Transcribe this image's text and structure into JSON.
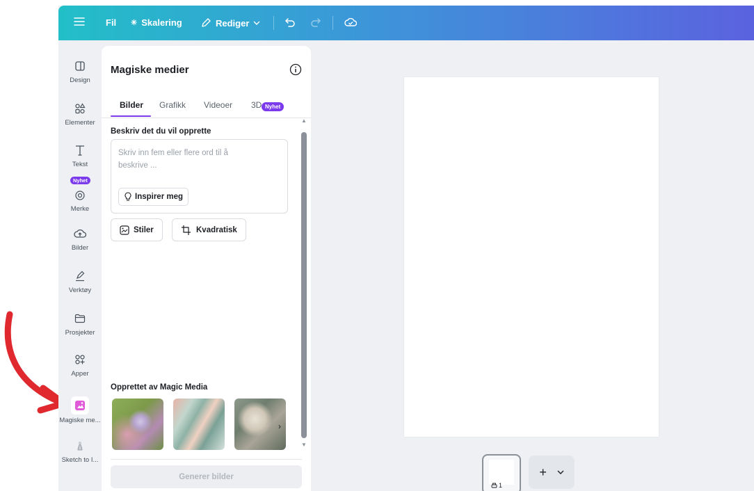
{
  "topbar": {
    "file_label": "Fil",
    "resize_label": "Skalering",
    "edit_label": "Rediger"
  },
  "rail": {
    "items": [
      {
        "label": "Design",
        "icon": "layout-icon"
      },
      {
        "label": "Elementer",
        "icon": "shapes-icon"
      },
      {
        "label": "Tekst",
        "icon": "text-icon"
      },
      {
        "label": "Merke",
        "icon": "brand-icon",
        "badge": "Nyhet"
      },
      {
        "label": "Bilder",
        "icon": "cloud-upload-icon"
      },
      {
        "label": "Verktøy",
        "icon": "pen-icon"
      },
      {
        "label": "Prosjekter",
        "icon": "folder-icon"
      },
      {
        "label": "Apper",
        "icon": "apps-icon"
      },
      {
        "label": "Magiske me...",
        "icon": "magic-media-icon"
      },
      {
        "label": "Sketch to I...",
        "icon": "sketch-icon"
      }
    ]
  },
  "panel": {
    "title": "Magiske medier",
    "tabs": [
      {
        "label": "Bilder"
      },
      {
        "label": "Grafikk"
      },
      {
        "label": "Videoer"
      },
      {
        "label": "3D"
      }
    ],
    "tab_badge": "Nyhet",
    "describe_label": "Beskriv det du vil opprette",
    "prompt_placeholder": "Skriv inn fem eller flere ord til å beskrive ...",
    "inspire_label": "Inspirer meg",
    "styles_label": "Stiler",
    "aspect_label": "Kvadratisk",
    "created_label": "Opprettet av Magic Media",
    "generate_label": "Generer bilder"
  },
  "pages": {
    "page_number": "1"
  },
  "colors": {
    "accent": "#7c3aed",
    "topbar_start": "#22bfc8",
    "topbar_end": "#5b62df",
    "arrow": "#e0282f"
  }
}
